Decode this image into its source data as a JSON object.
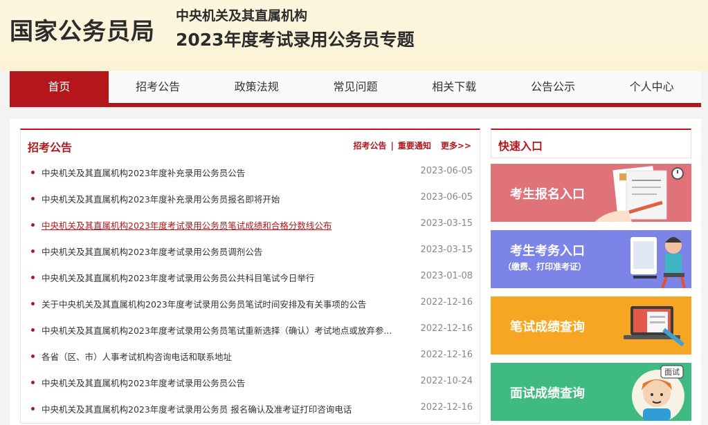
{
  "header": {
    "brand": "国家公务员局",
    "topic_sub": "中央机关及其直属机构",
    "topic_main": "2023年度考试录用公务员专题"
  },
  "nav": {
    "items": [
      {
        "label": "首页"
      },
      {
        "label": "招考公告"
      },
      {
        "label": "政策法规"
      },
      {
        "label": "常见问题"
      },
      {
        "label": "相关下载"
      },
      {
        "label": "公告公示"
      },
      {
        "label": "个人中心"
      }
    ]
  },
  "news": {
    "title": "招考公告",
    "link1": "招考公告",
    "sep": "|",
    "link2": "重要通知",
    "more": "更多>>",
    "items": [
      {
        "title": "中央机关及其直属机构2023年度补充录用公务员公告",
        "date": "2023-06-05"
      },
      {
        "title": "中央机关及其直属机构2023年度补充录用公务员报名即将开始",
        "date": "2023-06-05"
      },
      {
        "title": "中央机关及其直属机构2023年度考试录用公务员笔试成绩和合格分数线公布",
        "date": "2023-03-15"
      },
      {
        "title": "中央机关及其直属机构2023年度考试录用公务员调剂公告",
        "date": "2023-03-15"
      },
      {
        "title": "中央机关及其直属机构2023年度考试录用公务员公共科目笔试今日举行",
        "date": "2023-01-08"
      },
      {
        "title": "关于中央机关及其直属机构2023年度考试录用公务员笔试时间安排及有关事项的公告",
        "date": "2022-12-16"
      },
      {
        "title": "中央机关及其直属机构2023年度考试录用公务员笔试重新选择（确认）考试地点或放弃参...",
        "date": "2022-12-16"
      },
      {
        "title": "各省（区、市）人事考试机构咨询电话和联系地址",
        "date": "2022-12-16"
      },
      {
        "title": "中央机关及其直属机构2023年度考试录用公务员公告",
        "date": "2022-10-24"
      },
      {
        "title": "中央机关及其直属机构2023年度考试录用公务员 报名确认及准考证打印咨询电话",
        "date": "2022-12-16"
      }
    ]
  },
  "quick": {
    "title": "快速入口",
    "tiles": [
      {
        "label": "考生报名入口",
        "color": "#e0727a",
        "icon": "document-pen-icon"
      },
      {
        "label": "考生考务入口",
        "sub": "（缴费、打印准考证）",
        "color": "#7c84e8",
        "icon": "person-computer-icon"
      },
      {
        "label": "笔试成绩查询",
        "color": "#f7a623",
        "icon": "laptop-icon"
      },
      {
        "label": "面试成绩查询",
        "color": "#3fba82",
        "icon": "person-face-icon",
        "badge": "面试"
      }
    ]
  }
}
